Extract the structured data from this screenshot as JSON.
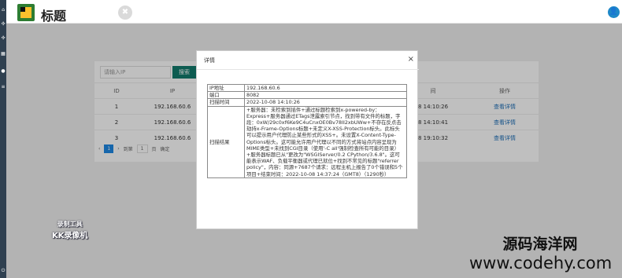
{
  "header": {
    "title": "标题",
    "close_glyph": "✖",
    "user_glyph": "👤"
  },
  "rail": {
    "icons": [
      "home-icon",
      "share-icon",
      "share-icon",
      "grid-icon",
      "map-pin-icon",
      "list-icon"
    ],
    "power_glyph": "⏻"
  },
  "search": {
    "placeholder": "请输入IP",
    "button": "搜索"
  },
  "table": {
    "headers": [
      "ID",
      "IP",
      "",
      "间",
      "操作"
    ],
    "rows": [
      {
        "id": "1",
        "ip": "192.168.60.6",
        "time": "8 14:10:26",
        "action": "查看详情"
      },
      {
        "id": "2",
        "ip": "192.168.60.6",
        "time": "8 14:10:41",
        "action": "查看详情"
      },
      {
        "id": "3",
        "ip": "192.168.60.6",
        "time": "8 19:10:32",
        "action": "查看详情"
      }
    ]
  },
  "pager": {
    "prev": "‹",
    "current": "1",
    "next": "›",
    "goto": "到第",
    "page": "1",
    "unit": "页",
    "confirm": "确定"
  },
  "dialog": {
    "title": "详情",
    "close": "×",
    "rows": [
      {
        "label": "IP地址",
        "value": "192.168.60.6"
      },
      {
        "label": "端口",
        "value": "8082"
      },
      {
        "label": "扫描时间",
        "value": "2022-10-08 14:10:26"
      },
      {
        "label": "扫描结果",
        "value": "+服务器：未检索到插件+通过标题检索到x-powered-by：Express+服务器通过ETags泄露索引节点，找到带有文件的标题，字段：0xW/29c0xf6Ke9C4uCnxOE0Bv78II2xbUWw+不存在反点击劫持x-Frame-Options标题+未定义X-XSS-Protection标头。此标头可以提示用户代理防止某些形式的XSS+。未设置X-Content-Type-Options标头。这可能允许用户代理以不同的方式将站点内容呈现为MIME类型+未找到CGI目录（使用'-C all'强制检查所有可能的目录）+服务器标题已从\"更改为\"WSGIServer/0.2 CPython/3.6.8\"。这可能表示WAF、负载平衡器或代理已就位+找到不常见的标题\"referrer policy\"，内容：同源+7687个请求：远程主机上报告了0个错误和5个项目+结束时间：2022-10-08 14:37:24（GMT8）（1290秒）"
      }
    ]
  },
  "watermarks": {
    "recorder_line1": "录制工具",
    "recorder_line2": "KK录像机",
    "site_name": "源码海洋网",
    "site_url": "www.codehy.com"
  }
}
